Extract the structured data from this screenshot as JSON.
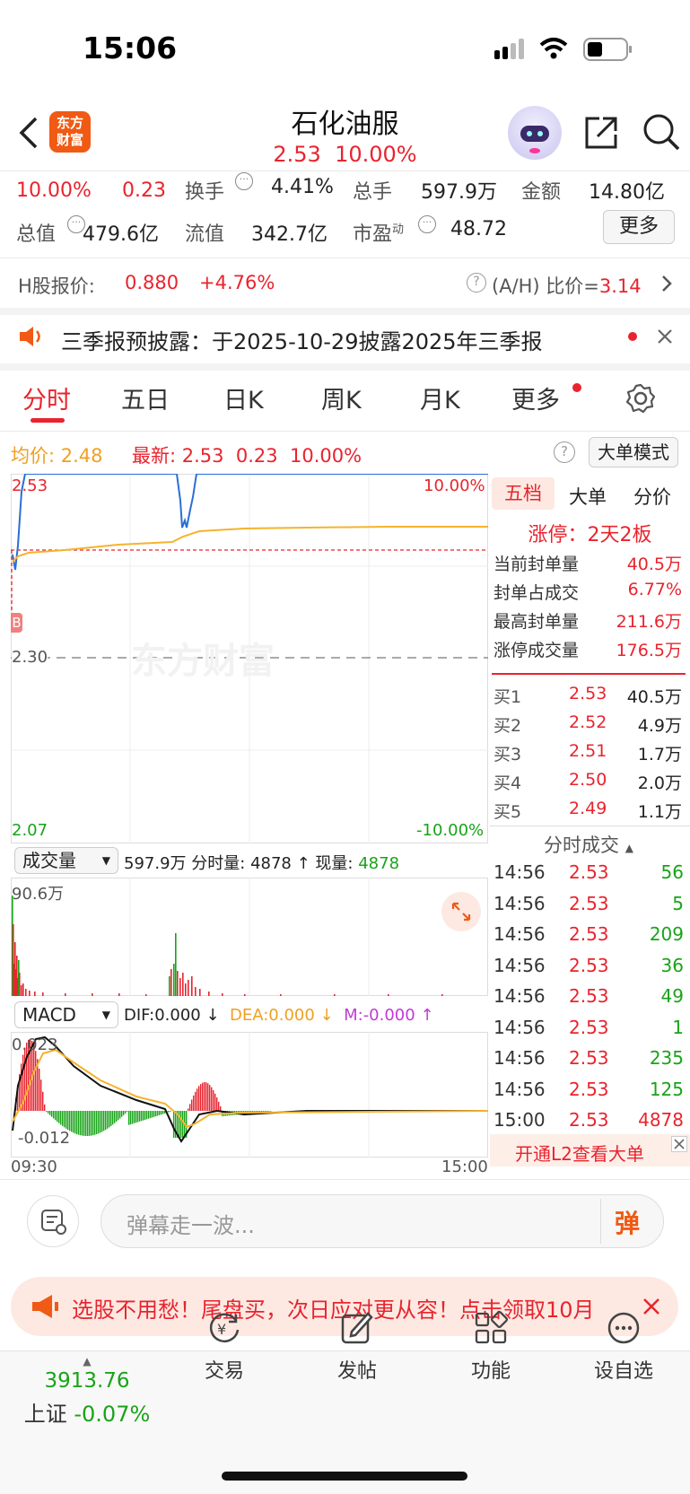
{
  "status": {
    "time": "15:06"
  },
  "header": {
    "title": "石化油服",
    "price": "2.53",
    "pct": "10.00%",
    "logo_text_1": "东方",
    "logo_text_2": "财富"
  },
  "quote": {
    "pct": "10.00%",
    "chg": "0.23",
    "turnover_label": "换手",
    "turnover": "4.41%",
    "volume_label": "总手",
    "volume": "597.9万",
    "amount_label": "金额",
    "amount": "14.80亿",
    "mktcap_label": "总值",
    "mktcap": "479.6亿",
    "float_label": "流值",
    "float": "342.7亿",
    "pe_label": "市盈",
    "pe_sup": "动",
    "pe": "48.72",
    "more": "更多"
  },
  "hshare": {
    "label": "H股报价:",
    "price": "0.880",
    "pct": "+4.76%",
    "ratio_label": "(A/H) 比价=",
    "ratio": "3.14"
  },
  "notice": {
    "text": "三季报预披露：于2025-10-29披露2025年三季报"
  },
  "tabs": [
    "分时",
    "五日",
    "日K",
    "周K",
    "月K",
    "更多"
  ],
  "avgbar": {
    "avg_label": "均价:",
    "avg": "2.48",
    "last_label": "最新:",
    "last": "2.53",
    "chg": "0.23",
    "pct": "10.00%",
    "mode": "大单模式"
  },
  "chart": {
    "ymax": "2.53",
    "ymid": "2.30",
    "ymin": "2.07",
    "pmax": "10.00%",
    "pmin": "-10.00%",
    "watermark": "东方财富",
    "marker": "B"
  },
  "chart_data": {
    "type": "line",
    "x": [
      "09:30",
      "15:00"
    ],
    "series": [
      {
        "name": "价格",
        "values": [
          2.45,
          2.53,
          2.53,
          2.53,
          2.53,
          2.48,
          2.53,
          2.53,
          2.53
        ]
      },
      {
        "name": "均价",
        "values": [
          2.45,
          2.46,
          2.47,
          2.475,
          2.48,
          2.48,
          2.48,
          2.48,
          2.48
        ]
      }
    ],
    "ylim": [
      2.07,
      2.53
    ]
  },
  "vol": {
    "label": "成交量",
    "total": "597.9万",
    "fsl_label": "分时量:",
    "fsl": "4878",
    "cur_label": "现量:",
    "cur": "4878",
    "max": "90.6万"
  },
  "macd": {
    "label": "MACD",
    "dif": "DIF:0.000",
    "dea": "DEA:0.000",
    "m": "M:-0.000",
    "top": "0.023",
    "bottom": "-0.012",
    "t_start": "09:30",
    "t_end": "15:00"
  },
  "side": {
    "tabs": [
      "五档",
      "大单",
      "分价"
    ],
    "limit": "涨停：2天2板",
    "stats": [
      {
        "k": "当前封单量",
        "v": "40.5万"
      },
      {
        "k": "封单占成交",
        "v": "6.77%"
      },
      {
        "k": "最高封单量",
        "v": "211.6万"
      },
      {
        "k": "涨停成交量",
        "v": "176.5万"
      }
    ],
    "bids": [
      {
        "k": "买1",
        "p": "2.53",
        "v": "40.5万"
      },
      {
        "k": "买2",
        "p": "2.52",
        "v": "4.9万"
      },
      {
        "k": "买3",
        "p": "2.51",
        "v": "1.7万"
      },
      {
        "k": "买4",
        "p": "2.50",
        "v": "2.0万"
      },
      {
        "k": "买5",
        "p": "2.49",
        "v": "1.1万"
      }
    ],
    "ticks_title": "分时成交",
    "ticks": [
      {
        "t": "14:56",
        "p": "2.53",
        "v": "56"
      },
      {
        "t": "14:56",
        "p": "2.53",
        "v": "5"
      },
      {
        "t": "14:56",
        "p": "2.53",
        "v": "209"
      },
      {
        "t": "14:56",
        "p": "2.53",
        "v": "36"
      },
      {
        "t": "14:56",
        "p": "2.53",
        "v": "49"
      },
      {
        "t": "14:56",
        "p": "2.53",
        "v": "1"
      },
      {
        "t": "14:56",
        "p": "2.53",
        "v": "235"
      },
      {
        "t": "14:56",
        "p": "2.53",
        "v": "125"
      },
      {
        "t": "15:00",
        "p": "2.53",
        "v": "4878"
      }
    ],
    "l2": "开通L2查看大单"
  },
  "danmu": {
    "placeholder": "弹幕走一波...",
    "btn": "弹"
  },
  "promo": {
    "text": "选股不用愁！尾盘买，次日应对更从容！点击领取10月"
  },
  "nav": {
    "index_value": "3913.76",
    "index_name": "上证",
    "index_pct": "-0.07%",
    "items": [
      "交易",
      "发帖",
      "功能",
      "设自选"
    ]
  }
}
